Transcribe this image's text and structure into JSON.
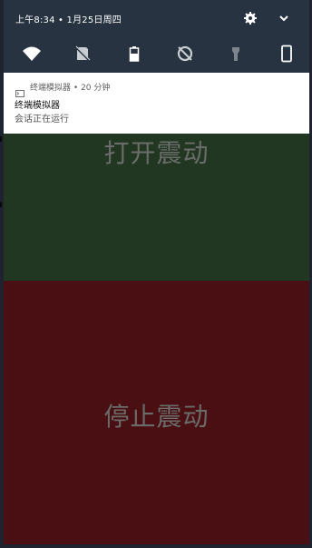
{
  "status_bar": {
    "time_date": "上午8:34 • 1月25日周四",
    "icons": [
      "gear-icon",
      "chevron-down-icon"
    ]
  },
  "quick_settings": {
    "tiles": [
      "wifi-icon",
      "no-sim-icon",
      "battery-icon",
      "data-saver-off-icon",
      "flashlight-icon",
      "phone-icon"
    ]
  },
  "notification": {
    "app_name": "终端模拟器",
    "separator": "•",
    "time_ago": "20 分钟",
    "title": "终端模拟器",
    "body": "会话正在运行"
  },
  "buttons": {
    "start_vibration": "打开震动",
    "stop_vibration": "停止震动"
  },
  "colors": {
    "shade_bg": "#273340",
    "green_panel": "#223722",
    "red_panel": "#4a0f12",
    "label_color": "#6a6c6a"
  }
}
